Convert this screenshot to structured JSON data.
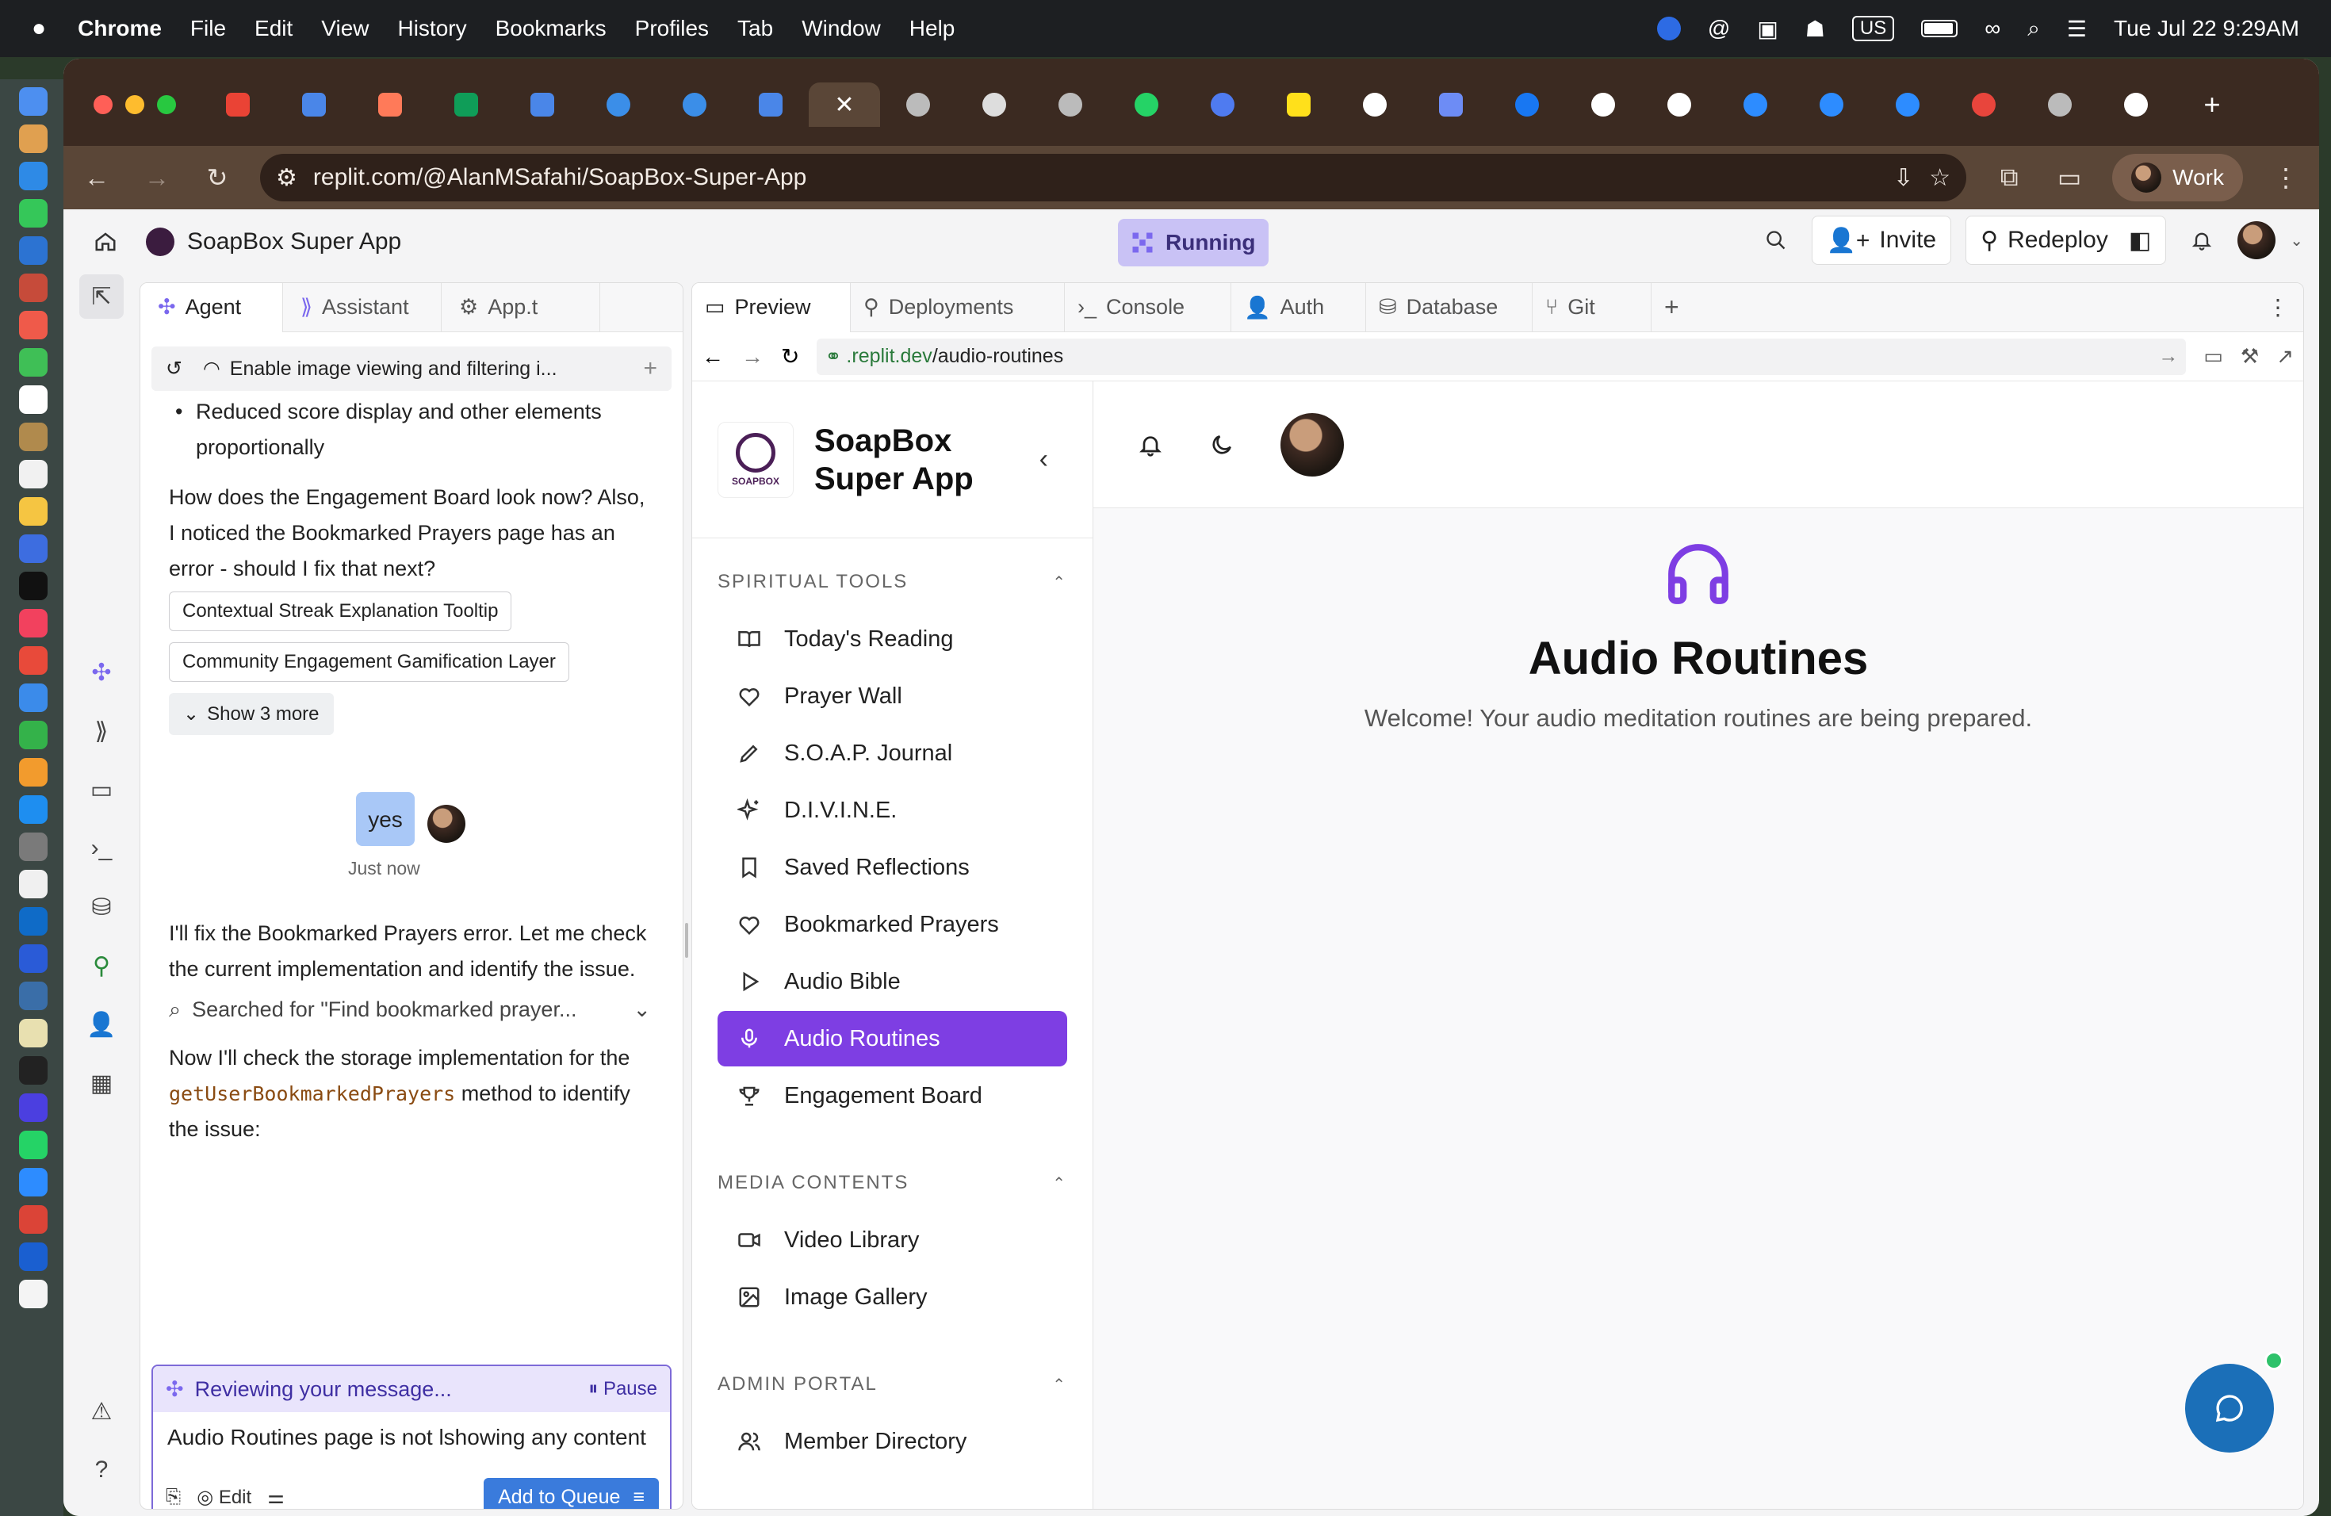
{
  "menubar": {
    "app": "Chrome",
    "items": [
      "File",
      "Edit",
      "View",
      "History",
      "Bookmarks",
      "Profiles",
      "Tab",
      "Window",
      "Help"
    ],
    "clock": "Tue Jul 22  9:29AM",
    "input_source": "US"
  },
  "browser": {
    "url": "replit.com/@AlanMSafahi/SoapBox-Super-App",
    "profile": "Work"
  },
  "replit": {
    "project": "SoapBox Super App",
    "status": "Running",
    "invite": "Invite",
    "redeploy": "Redeploy"
  },
  "agent": {
    "tabs": [
      "Agent",
      "Assistant",
      "App.t"
    ],
    "history_title": "Enable image viewing and filtering i...",
    "bullet": "Reduced score display and other elements proportionally",
    "question": "How does the Engagement Board look now? Also, I noticed the Bookmarked Prayers page has an error - should I fix that next?",
    "chips": [
      "Contextual Streak Explanation Tooltip",
      "Community Engagement Gamification Layer"
    ],
    "show_more": "Show 3 more",
    "user_msg": "yes",
    "user_time": "Just now",
    "reply1": "I'll fix the Bookmarked Prayers error. Let me check the current implementation and identify the issue.",
    "search": "Searched for \"Find bookmarked prayer...",
    "reply2_pre": "Now I'll check the storage implementation for the",
    "reply2_code": "getUserBookmarkedPrayers",
    "reply2_post": "method to identify the issue:",
    "reviewing": "Reviewing your message...",
    "pause": "Pause",
    "input": "Audio Routines page is not lshowing any content",
    "edit": "Edit",
    "queue": "Add to Queue"
  },
  "preview": {
    "tabs": [
      "Preview",
      "Deployments",
      "Console",
      "Auth",
      "Database",
      "Git"
    ],
    "url_host": ".replit.dev",
    "url_path": "/audio-routines",
    "brand": "SoapBox Super App",
    "logo_text": "SOAPBOX",
    "sections": [
      {
        "title": "SPIRITUAL TOOLS",
        "items": [
          {
            "label": "Today's Reading",
            "icon": "book-icon"
          },
          {
            "label": "Prayer Wall",
            "icon": "heart-icon"
          },
          {
            "label": "S.O.A.P. Journal",
            "icon": "pen-icon"
          },
          {
            "label": "D.I.V.I.N.E.",
            "icon": "sparkles-icon"
          },
          {
            "label": "Saved Reflections",
            "icon": "bookmark-icon"
          },
          {
            "label": "Bookmarked Prayers",
            "icon": "heart-icon"
          },
          {
            "label": "Audio Bible",
            "icon": "play-icon"
          },
          {
            "label": "Audio Routines",
            "icon": "mic-icon",
            "active": true
          },
          {
            "label": "Engagement Board",
            "icon": "trophy-icon"
          }
        ]
      },
      {
        "title": "MEDIA CONTENTS",
        "items": [
          {
            "label": "Video Library",
            "icon": "video-icon"
          },
          {
            "label": "Image Gallery",
            "icon": "image-icon"
          }
        ]
      },
      {
        "title": "ADMIN PORTAL",
        "items": [
          {
            "label": "Member Directory",
            "icon": "users-icon"
          }
        ]
      }
    ],
    "heading": "Audio Routines",
    "subtitle": "Welcome! Your audio meditation routines are being prepared.",
    "accent": "#7e3ee3"
  }
}
